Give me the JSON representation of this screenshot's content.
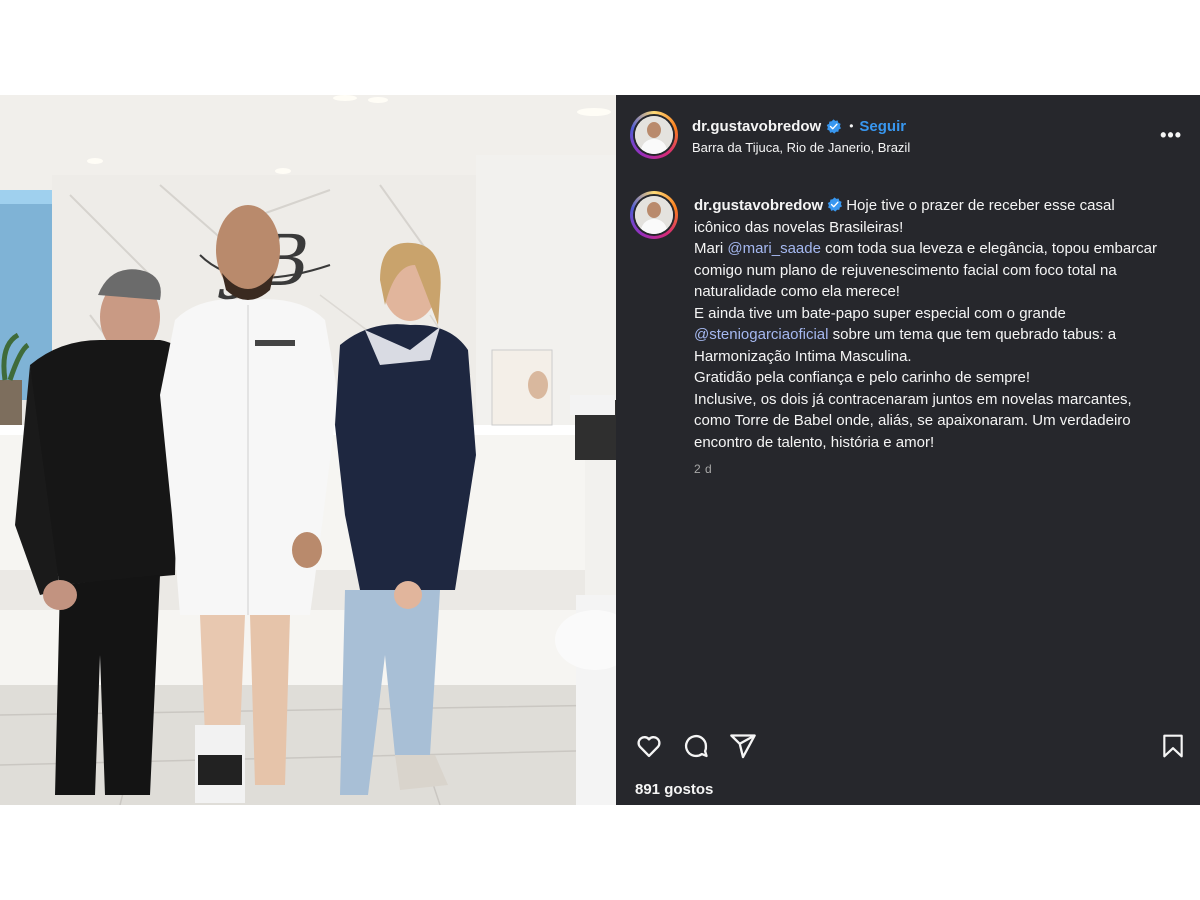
{
  "post": {
    "username": "dr.gustavobredow",
    "follow_label": "Seguir",
    "separator": "•",
    "location": "Barra da Tijuca, Rio de Janerio, Brazil",
    "more_label": "•••",
    "caption": {
      "username": "dr.gustavobredow",
      "lines": [
        {
          "parts": [
            {
              "text": "Hoje tive o prazer de receber esse casal icônico das novelas Brasileiras!"
            }
          ]
        },
        {
          "parts": [
            {
              "text": "Mari "
            },
            {
              "text": "@mari_saade",
              "mention": true
            },
            {
              "text": " com toda sua leveza e elegância, topou embarcar comigo num plano de rejuvenescimento facial com foco total na naturalidade como ela merece!"
            }
          ]
        },
        {
          "parts": [
            {
              "text": "E ainda tive um bate-papo super especial com o grande "
            },
            {
              "text": "@steniogarciaoficial",
              "mention": true
            },
            {
              "text": " sobre um tema que tem quebrado tabus: a Harmonização Intima Masculina."
            }
          ]
        },
        {
          "parts": [
            {
              "text": "Gratidão pela confiança e pelo carinho de sempre!"
            }
          ]
        },
        {
          "parts": [
            {
              "text": "Inclusive, os dois já contracenaram juntos em novelas marcantes, como Torre de Babel onde, aliás, se apaixonaram. Um verdadeiro encontro de talento, história e amor!"
            }
          ]
        }
      ],
      "time": "2 d"
    },
    "likes_count": "891",
    "likes_label": "gostos",
    "icons": {
      "like": "heart-icon",
      "comment": "comment-icon",
      "share": "send-icon",
      "save": "bookmark-icon",
      "verified": "verified-badge-icon"
    },
    "colors": {
      "panel_bg": "#26272c",
      "link": "#3897f0",
      "mention": "#a5b8f0",
      "verified": "#3897f0"
    }
  }
}
